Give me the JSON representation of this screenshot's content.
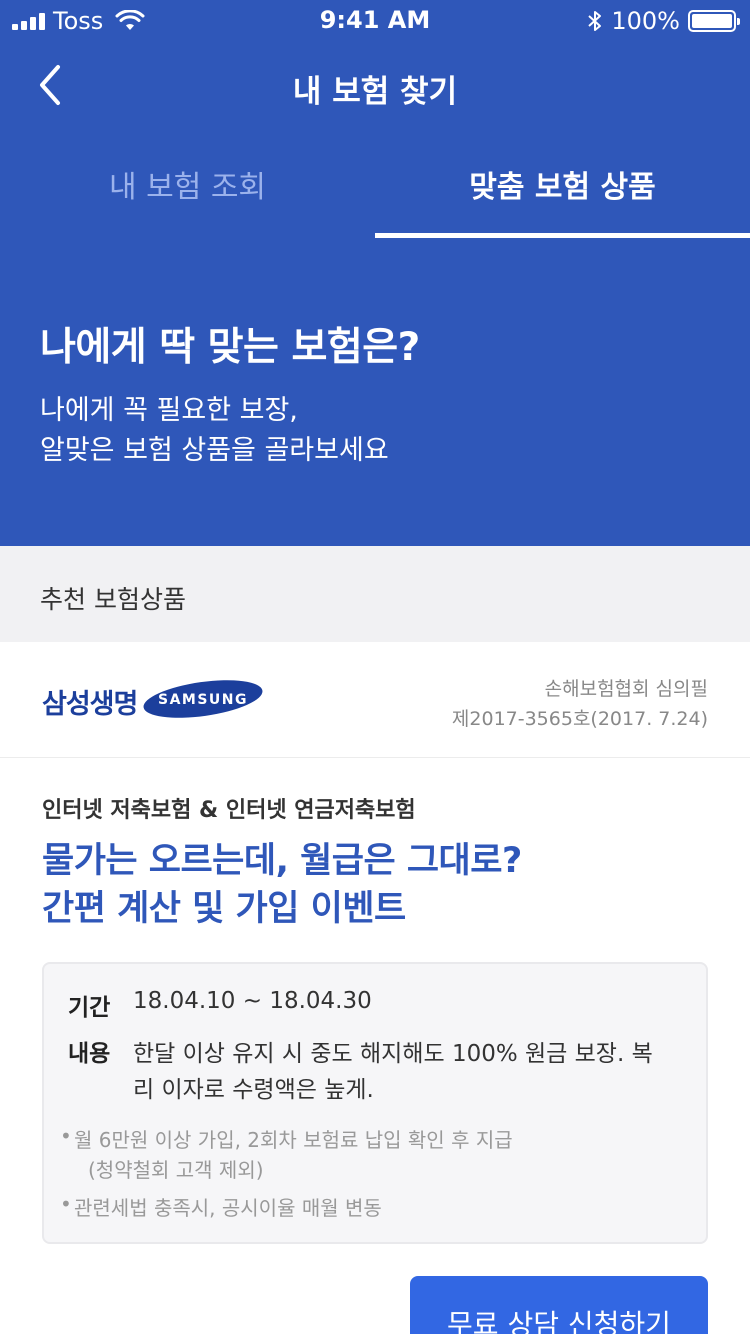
{
  "status_bar": {
    "carrier": "Toss",
    "time": "9:41 AM",
    "battery": "100%"
  },
  "nav": {
    "title": "내 보험 찾기"
  },
  "tabs": [
    {
      "label": "내 보험 조회",
      "active": false
    },
    {
      "label": "맞춤 보험 상품",
      "active": true
    }
  ],
  "hero": {
    "title": "나에게 딱 맞는 보험은?",
    "subtitle_line1": "나에게 꼭 필요한 보장,",
    "subtitle_line2": "알맞은 보험 상품을 골라보세요"
  },
  "section": {
    "title": "추천 보험상품"
  },
  "product": {
    "brand_kr": "삼성생명",
    "brand_en": "SAMSUNG",
    "review_line1": "손해보험협회 심의필",
    "review_line2": "제2017-3565호(2017. 7.24)",
    "category": "인터넷 저축보험 & 인터넷 연금저축보험",
    "headline_line1": "물가는 오르는데, 월급은 그대로?",
    "headline_line2": "간편 계산 및 가입 이벤트",
    "period_label": "기간",
    "period_value": "18.04.10 ~ 18.04.30",
    "content_label": "내용",
    "content_line1": "한달 이상 유지 시 중도 해지해도 100% 원금 보장. 복",
    "content_line2": "리 이자로 수령액은 높게.",
    "note1_line1": "월 6만원 이상 가입, 2회차 보험료 납입 확인 후 지급",
    "note1_line2": "(청약철회 고객 제외)",
    "note2": "관련세법 충족시, 공시이율 매월 변동"
  },
  "cta": {
    "label": "무료 상담 신청하기"
  },
  "colors": {
    "brand_blue": "#2f57b9",
    "cta_blue": "#3267e3",
    "samsung_navy": "#1c3f9c"
  }
}
